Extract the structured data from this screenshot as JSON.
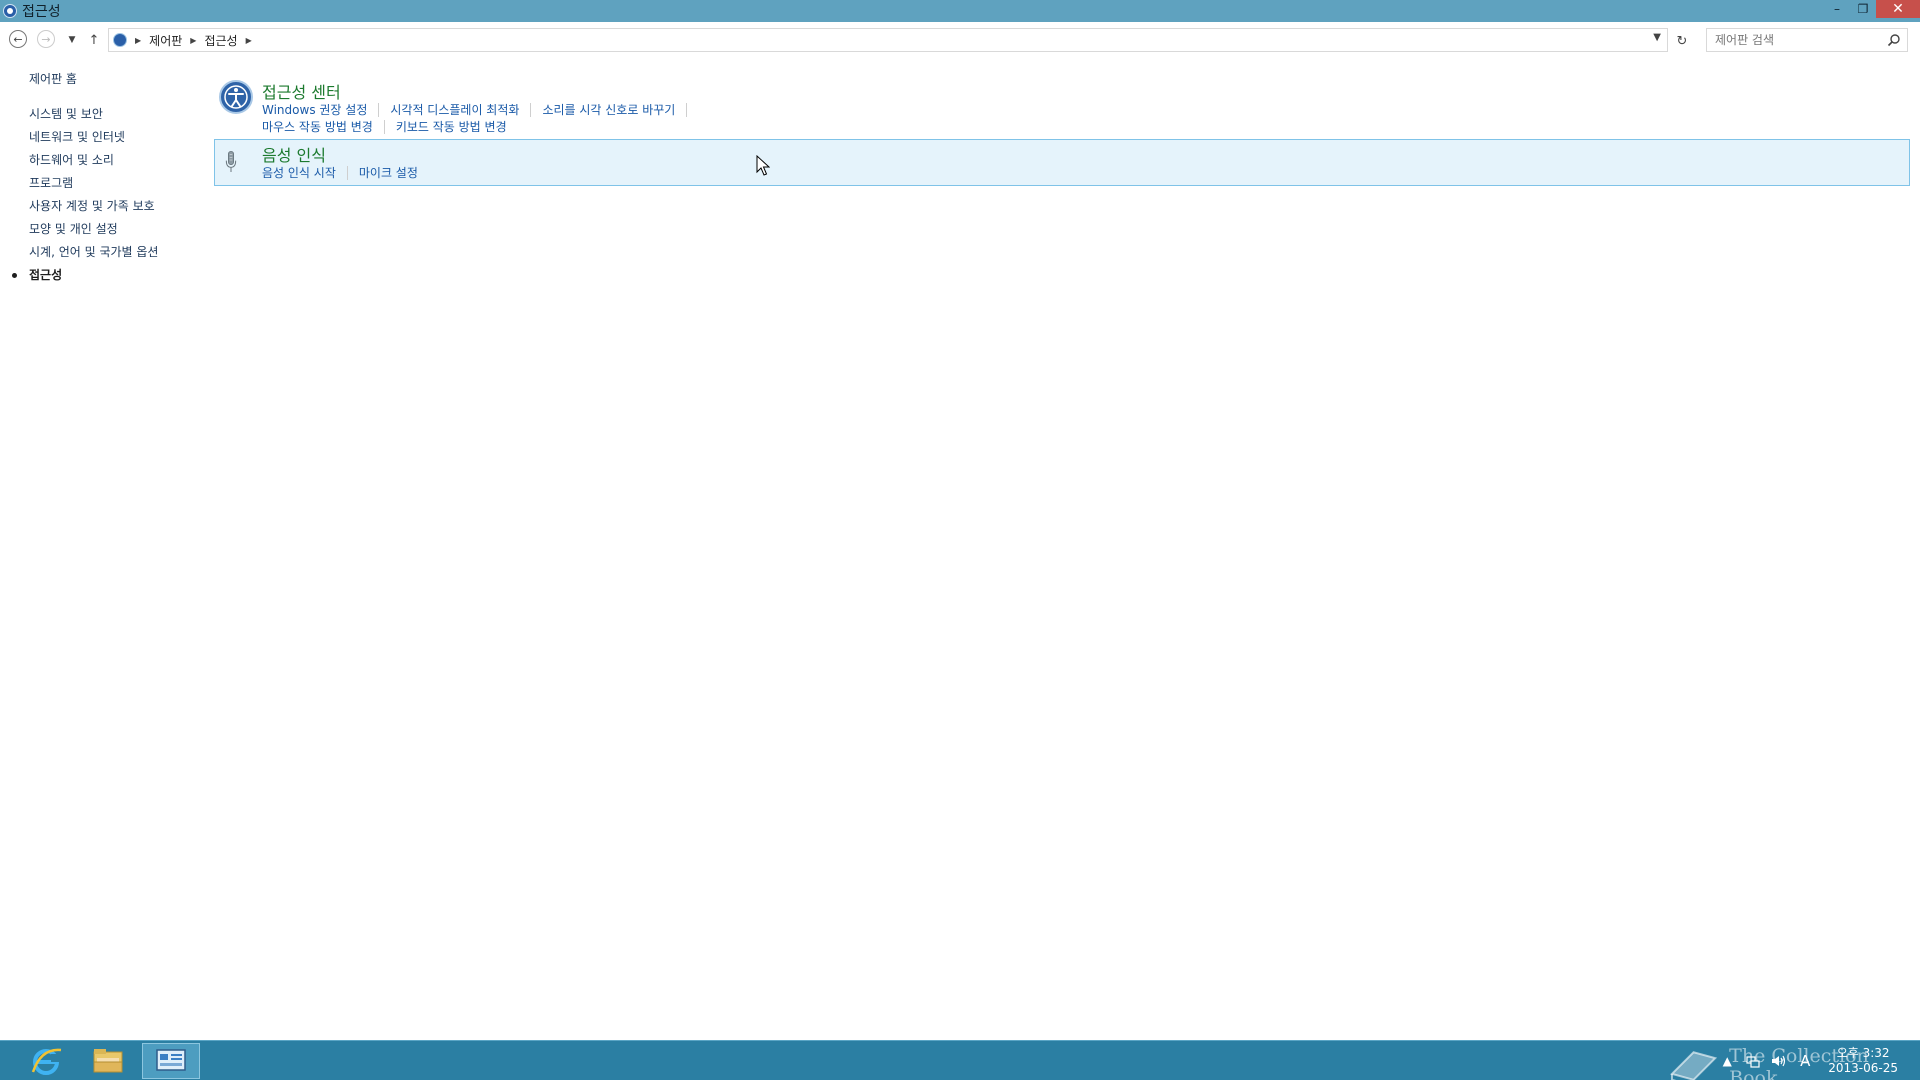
{
  "window": {
    "title": "접근성",
    "controls": {
      "minimize": "–",
      "restore": "❐",
      "close": "✕"
    }
  },
  "address": {
    "breadcrumbs": [
      "제어판",
      "접근성"
    ],
    "search_placeholder": "제어판 검색"
  },
  "sidebar": {
    "home": "제어판 홈",
    "items": [
      {
        "label": "시스템 및 보안"
      },
      {
        "label": "네트워크 및 인터넷"
      },
      {
        "label": "하드웨어 및 소리"
      },
      {
        "label": "프로그램"
      },
      {
        "label": "사용자 계정 및 가족 보호"
      },
      {
        "label": "모양 및 개인 설정"
      },
      {
        "label": "시계, 언어 및 국가별 옵션"
      },
      {
        "label": "접근성",
        "current": true
      }
    ]
  },
  "categories": [
    {
      "title": "접근성 센터",
      "icon": "ease-of-access-icon",
      "links_row1": [
        "Windows 권장 설정",
        "시각적 디스플레이 최적화",
        "소리를 시각 신호로 바꾸기"
      ],
      "links_row2": [
        "마우스 작동 방법 변경",
        "키보드 작동 방법 변경"
      ]
    },
    {
      "title": "음성 인식",
      "icon": "microphone-icon",
      "links_row1": [
        "음성 인식 시작",
        "마이크 설정"
      ],
      "highlighted": true
    }
  ],
  "taskbar": {
    "apps": [
      "internet-explorer-icon",
      "file-explorer-icon",
      "control-panel-icon"
    ],
    "active_app": "control-panel-icon",
    "clock_time": "오후 3:32",
    "clock_date": "2013-06-25",
    "ime": "A",
    "watermark": "The Collection Book"
  },
  "colors": {
    "titlebar": "#5fa2bf",
    "taskbar": "#2b7fa3",
    "category_title": "#1c7a2e",
    "link": "#1a5aa8",
    "highlight_bg": "#e5f3fb",
    "highlight_border": "#7fc3e8",
    "close_button": "#c7504b"
  }
}
